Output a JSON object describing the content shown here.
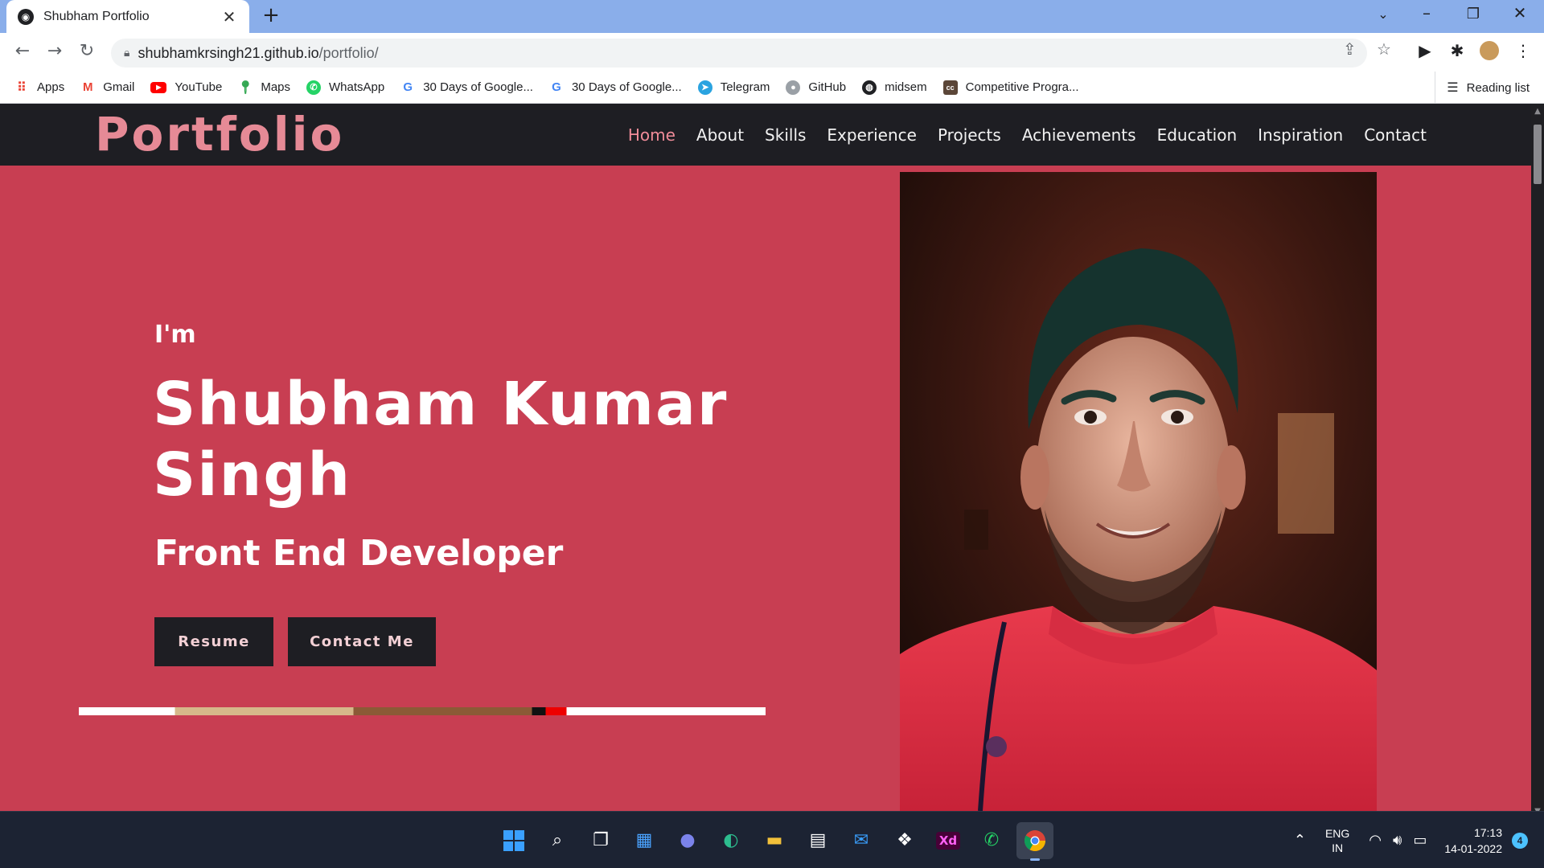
{
  "browser": {
    "tab_title": "Shubham Portfolio",
    "url_host": "shubhamkrsingh21.github.io",
    "url_path": "/portfolio/",
    "bookmarks": [
      {
        "label": "Apps",
        "icon": "apps-grid-icon",
        "color": "#ea4335"
      },
      {
        "label": "Gmail",
        "icon": "gmail-icon",
        "color": "#ea4335"
      },
      {
        "label": "YouTube",
        "icon": "youtube-icon",
        "color": "#ff0000"
      },
      {
        "label": "Maps",
        "icon": "maps-pin-icon",
        "color": "#34a853"
      },
      {
        "label": "WhatsApp",
        "icon": "whatsapp-icon",
        "color": "#25d366"
      },
      {
        "label": "30 Days of Google...",
        "icon": "google-icon",
        "color": "#4285f4"
      },
      {
        "label": "30 Days of Google...",
        "icon": "google-icon",
        "color": "#4285f4"
      },
      {
        "label": "Telegram",
        "icon": "telegram-icon",
        "color": "#2aa3e0"
      },
      {
        "label": "GitHub",
        "icon": "github-icon",
        "color": "#9aa0a6"
      },
      {
        "label": "midsem",
        "icon": "globe-icon",
        "color": "#202124"
      },
      {
        "label": "Competitive Progra...",
        "icon": "codechef-icon",
        "color": "#5b4638"
      }
    ],
    "reading_list": "Reading list"
  },
  "site": {
    "logo": "Portfolio",
    "nav": [
      {
        "label": "Home",
        "active": true
      },
      {
        "label": "About",
        "active": false
      },
      {
        "label": "Skills",
        "active": false
      },
      {
        "label": "Experience",
        "active": false
      },
      {
        "label": "Projects",
        "active": false
      },
      {
        "label": "Achievements",
        "active": false
      },
      {
        "label": "Education",
        "active": false
      },
      {
        "label": "Inspiration",
        "active": false
      },
      {
        "label": "Contact",
        "active": false
      }
    ],
    "hero": {
      "intro": "I'm",
      "name_line1": "Shubham Kumar",
      "name_line2": "Singh",
      "role": "Front End Developer",
      "resume_label": "Resume",
      "contact_label": "Contact Me"
    },
    "colors": {
      "hero_bg": "#c83e52",
      "nav_bg": "#1e1e23",
      "accent": "#f08c99"
    }
  },
  "taskbar": {
    "apps": [
      "windows-start-icon",
      "search-icon",
      "task-view-icon",
      "widgets-icon",
      "teams-chat-icon",
      "edge-icon",
      "file-explorer-icon",
      "microsoft-store-icon",
      "mail-icon",
      "dropbox-icon",
      "adobe-xd-icon",
      "whatsapp-icon",
      "chrome-icon"
    ],
    "lang_top": "ENG",
    "lang_bottom": "IN",
    "time": "17:13",
    "date": "14-01-2022",
    "notifications": "4"
  }
}
